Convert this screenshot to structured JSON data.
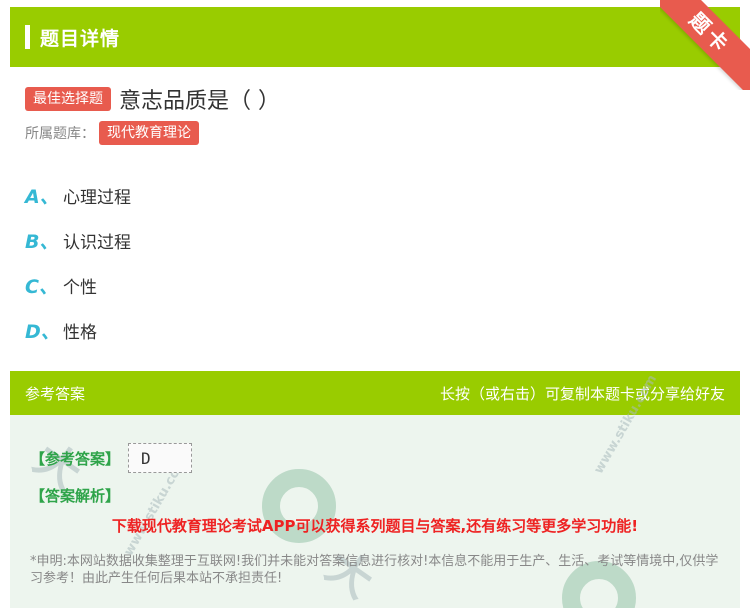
{
  "header": {
    "title": "题目详情"
  },
  "ribbon": {
    "label": "题卡"
  },
  "question": {
    "type_tag": "最佳选择题",
    "text": "意志品质是（ ）"
  },
  "category": {
    "label": "所属题库：",
    "value": "现代教育理论"
  },
  "options": [
    {
      "letter": "A、",
      "text": "心理过程"
    },
    {
      "letter": "B、",
      "text": "认识过程"
    },
    {
      "letter": "C、",
      "text": "个性"
    },
    {
      "letter": "D、",
      "text": "性格"
    }
  ],
  "answer": {
    "head_left": "参考答案",
    "head_right": "长按（或右击）可复制本题卡或分享给好友",
    "ref_label": "【参考答案】",
    "ref_value": "D",
    "analysis_label": "【答案解析】",
    "promo": "下载现代教育理论考试APP可以获得系列题目与答案,还有练习等更多学习功能!",
    "disclaimer": "*申明:本网站数据收集整理于互联网!我们并未能对答案信息进行核对!本信息不能用于生产、生活、考试等情境中,仅供学习参考！由此产生任何后果本站不承担责任!"
  },
  "colors": {
    "accent": "#99cc00",
    "tag": "#e85b4e",
    "option_letter": "#35b8d4",
    "answer_label": "#2fa44a",
    "promo": "#ee2222"
  }
}
